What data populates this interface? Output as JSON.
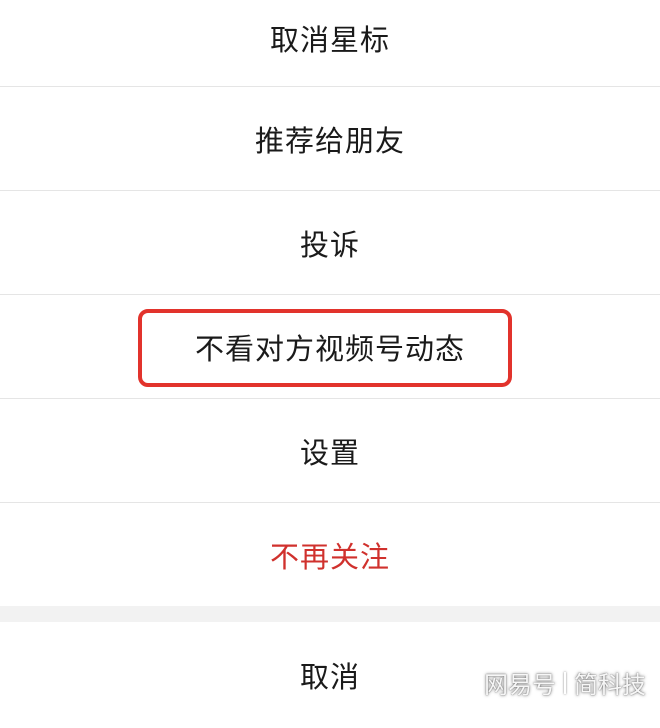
{
  "menu": {
    "items": [
      {
        "label": "取消星标"
      },
      {
        "label": "推荐给朋友"
      },
      {
        "label": "投诉"
      },
      {
        "label": "不看对方视频号动态",
        "highlighted": true
      },
      {
        "label": "设置"
      },
      {
        "label": "不再关注",
        "danger": true
      }
    ],
    "cancel_label": "取消"
  },
  "watermark": {
    "source": "网易号",
    "author": "简科技"
  },
  "colors": {
    "danger_text": "#d0312d",
    "highlight_border": "#e2332c",
    "divider": "#e5e5e5",
    "gap": "#f2f2f2"
  }
}
